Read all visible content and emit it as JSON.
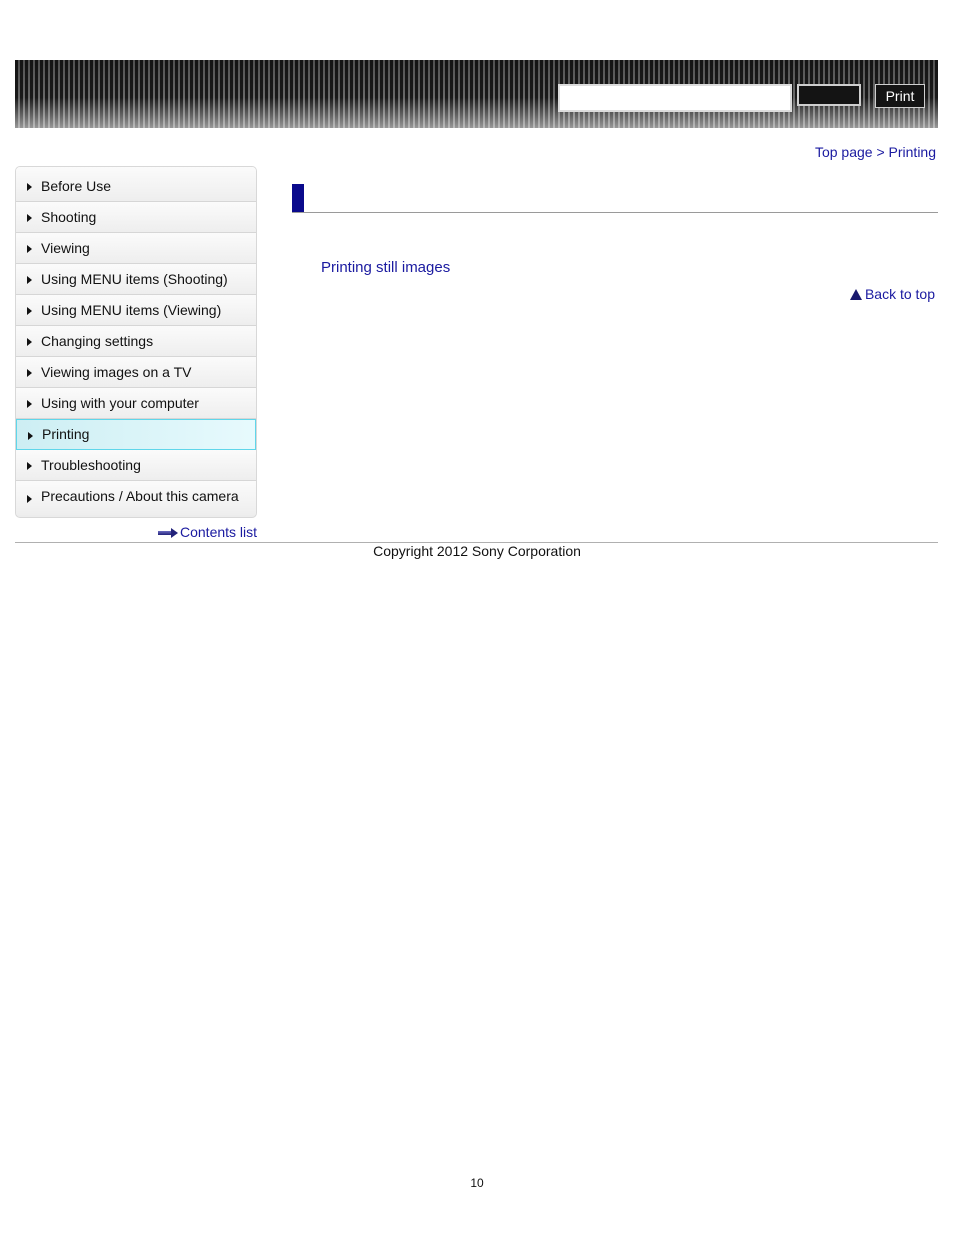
{
  "header": {
    "search_placeholder": "",
    "search_button_label": "",
    "print_button_label": "Print"
  },
  "breadcrumb": {
    "top_page": "Top page",
    "separator": ">",
    "current": "Printing"
  },
  "sidebar": {
    "items": [
      {
        "label": "Before Use"
      },
      {
        "label": "Shooting"
      },
      {
        "label": "Viewing"
      },
      {
        "label": "Using MENU items (Shooting)"
      },
      {
        "label": "Using MENU items (Viewing)"
      },
      {
        "label": "Changing settings"
      },
      {
        "label": "Viewing images on a TV"
      },
      {
        "label": "Using with your computer"
      },
      {
        "label": "Printing"
      },
      {
        "label": "Troubleshooting"
      },
      {
        "label": "Precautions / About this camera"
      }
    ],
    "active_index": 8,
    "contents_list_label": "Contents list"
  },
  "main": {
    "title": "",
    "links": [
      {
        "label": "Printing still images"
      }
    ],
    "back_to_top_label": "Back to top"
  },
  "footer": {
    "copyright": "Copyright 2012 Sony Corporation",
    "page_number": "10"
  },
  "colors": {
    "link": "#1a1aa0",
    "title_marker": "#0a0a8c",
    "active_nav_border": "#5fd6ea"
  }
}
